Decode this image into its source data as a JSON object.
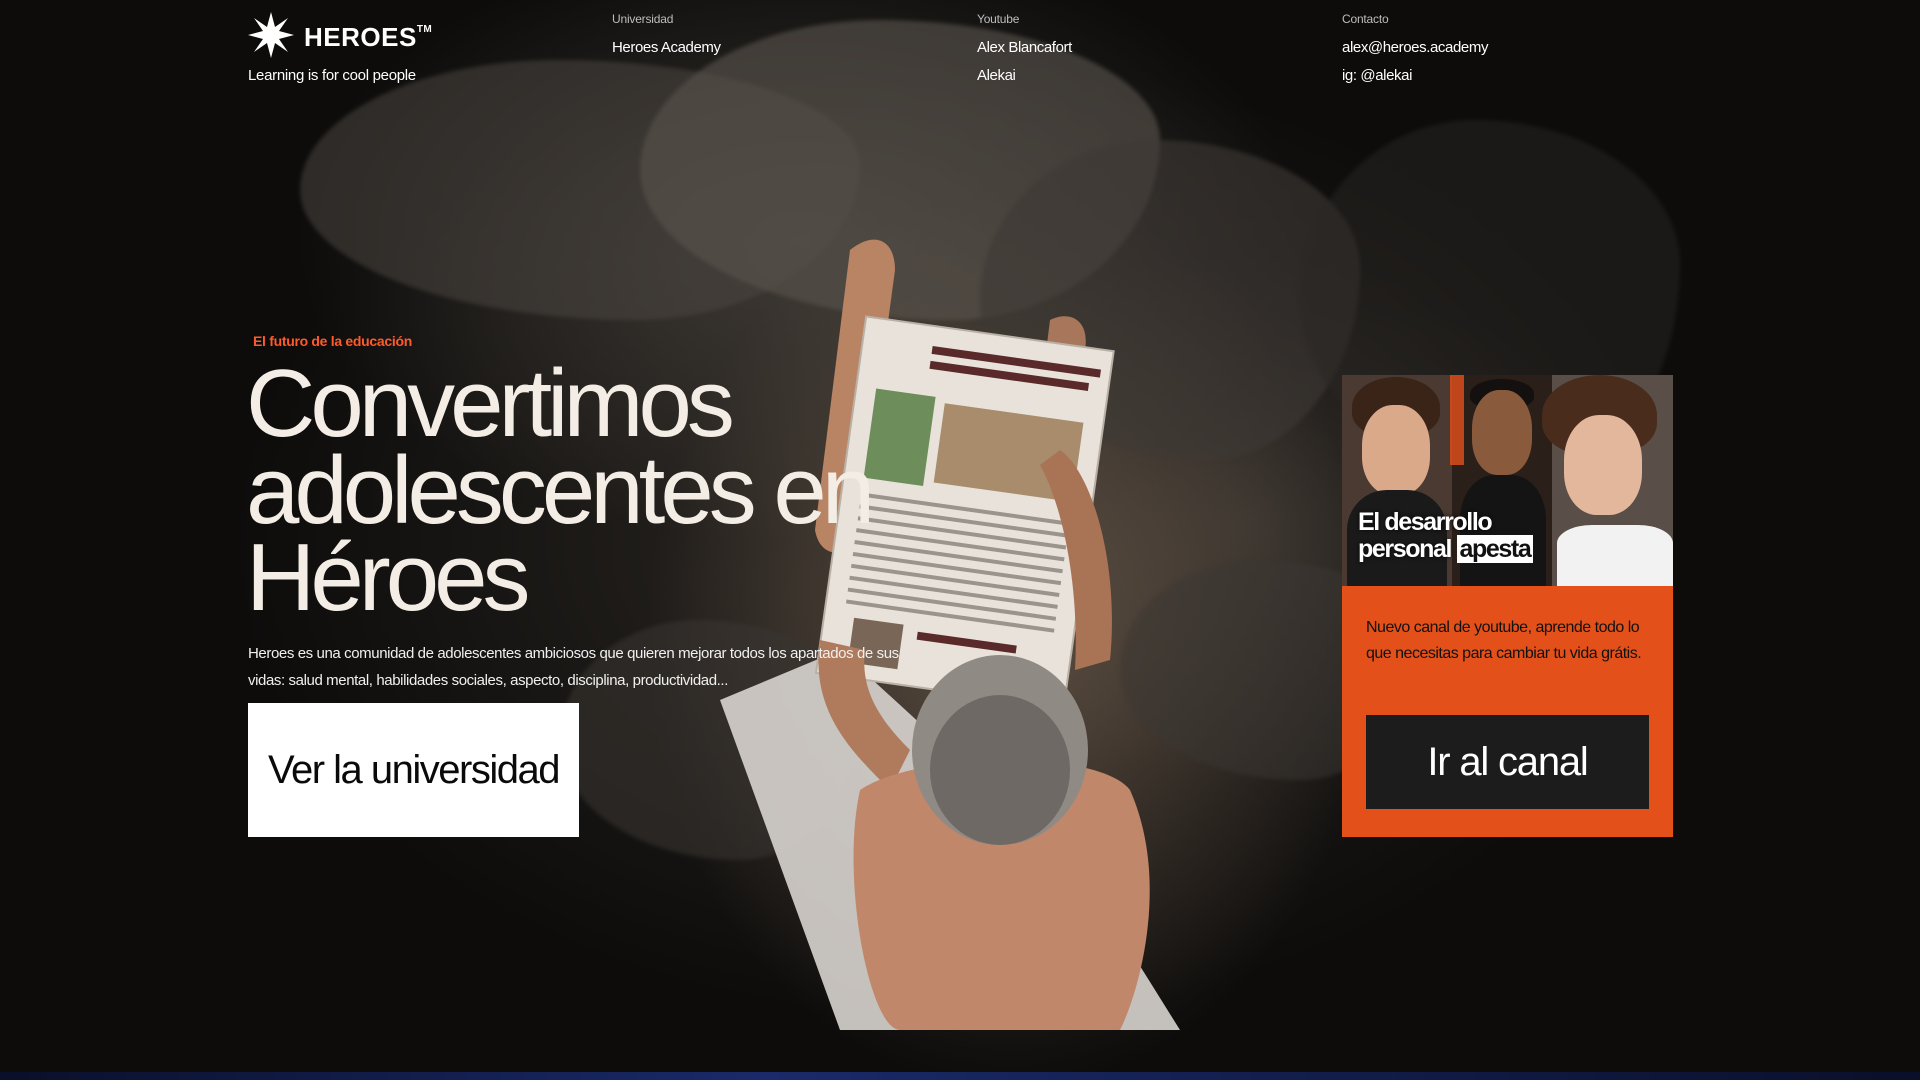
{
  "brand": {
    "name": "HEROES",
    "trademark": "TM",
    "tagline": "Learning is for cool people"
  },
  "header": {
    "columns": [
      {
        "title": "Universidad",
        "items": [
          "Heroes Academy"
        ]
      },
      {
        "title": "Youtube",
        "items": [
          "Alex Blancafort",
          "Alekai"
        ]
      },
      {
        "title": "Contacto",
        "items": [
          "alex@heroes.academy",
          "ig: @alekai"
        ]
      }
    ]
  },
  "hero": {
    "eyebrow": "El futuro de la educación",
    "headline": "Convertimos adolescentes en Héroes",
    "description": "Heroes es una comunidad de adolescentes ambiciosos que quieren mejorar todos los apartados de sus vidas: salud mental, habilidades sociales, aspecto, disciplina, productividad...",
    "cta_label": "Ver la universidad"
  },
  "card": {
    "thumb_line1": "El desarrollo",
    "thumb_line2": "personal",
    "thumb_highlight": "apesta",
    "text": "Nuevo canal de youtube, aprende todo lo que necesitas para cambiar tu vida grátis.",
    "cta_label": "Ir al canal"
  },
  "colors": {
    "accent": "#e4501a",
    "eyebrow": "#ff5a2a",
    "headline": "#f3ede6",
    "button_dark": "#1c1c1c"
  },
  "icons": {
    "logo": "starburst-icon"
  }
}
